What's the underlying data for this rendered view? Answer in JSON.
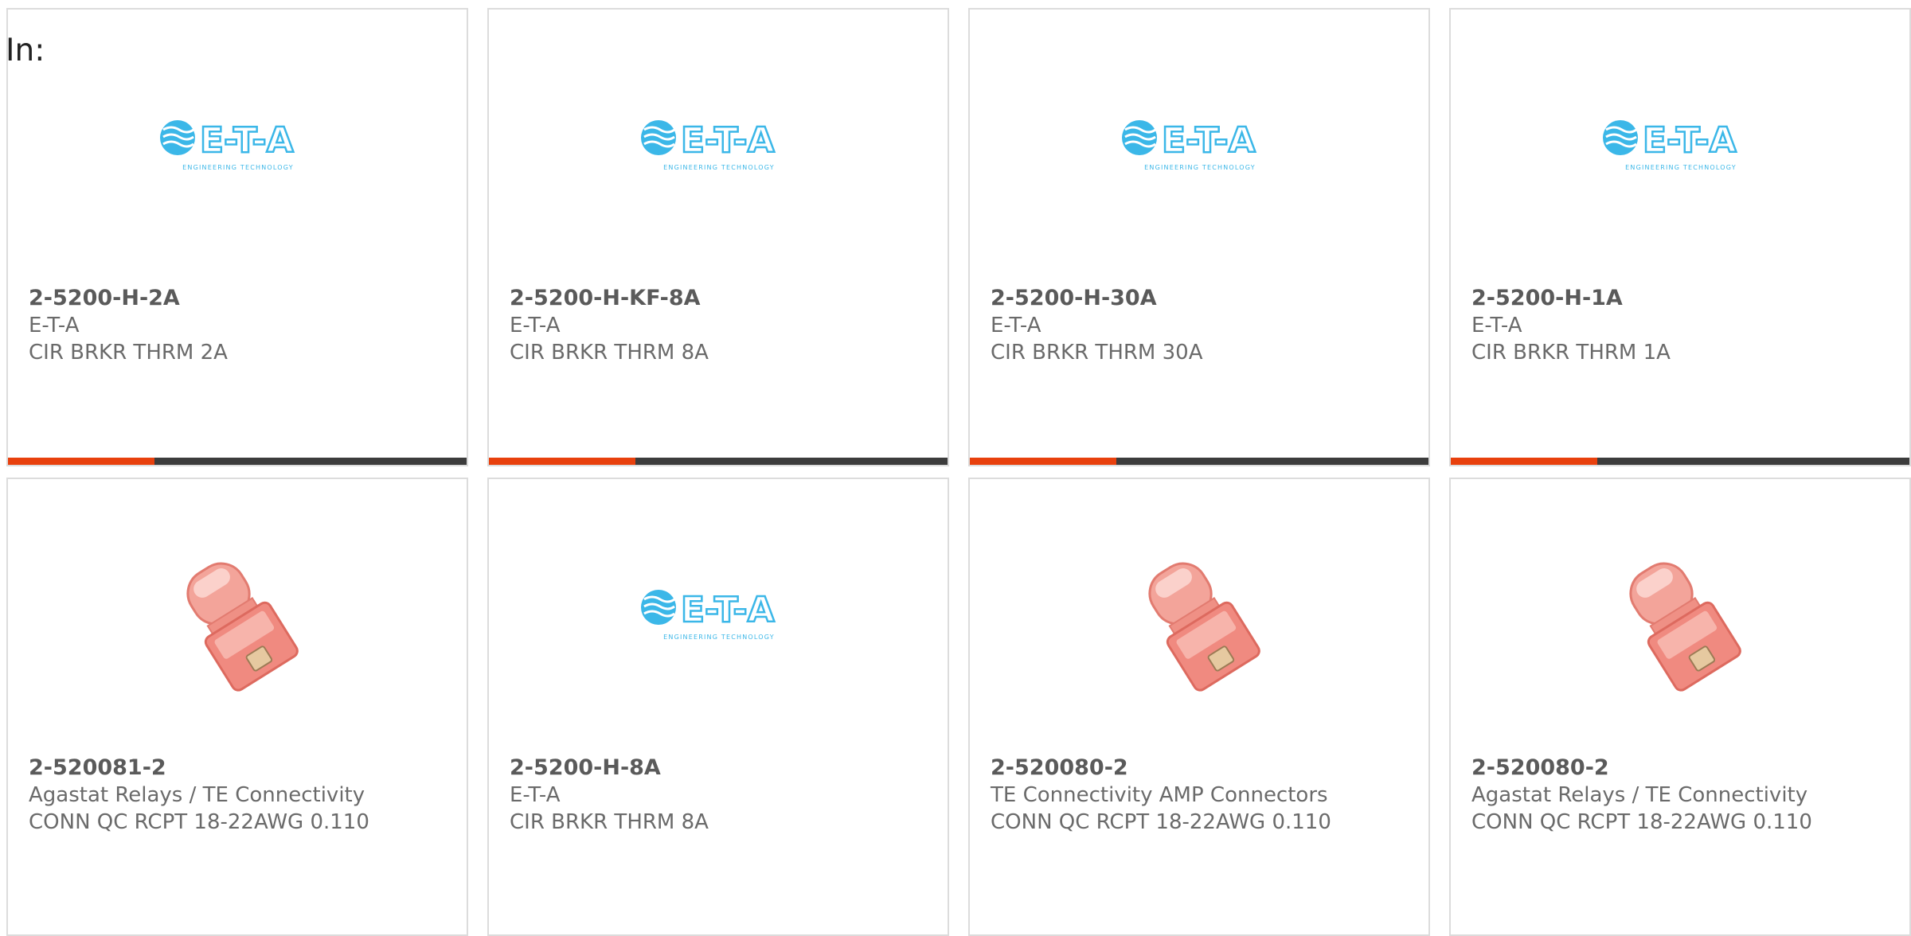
{
  "filter": {
    "label": "In:"
  },
  "colors": {
    "accent": "#e8400d",
    "bar_track": "#3c3c3c",
    "card_border": "#dcdcdc",
    "logo_blue": "#3bb7e8"
  },
  "products": [
    {
      "part_number": "2-5200-H-2A",
      "manufacturer": "E-T-A",
      "description": "CIR BRKR THRM 2A",
      "image": "eta-logo",
      "logo_text": "E-T-A",
      "logo_tagline": "ENGINEERING TECHNOLOGY",
      "progress": 0.32
    },
    {
      "part_number": "2-5200-H-KF-8A",
      "manufacturer": "E-T-A",
      "description": "CIR BRKR THRM 8A",
      "image": "eta-logo",
      "logo_text": "E-T-A",
      "logo_tagline": "ENGINEERING TECHNOLOGY",
      "progress": 0.32
    },
    {
      "part_number": "2-5200-H-30A",
      "manufacturer": "E-T-A",
      "description": "CIR BRKR THRM 30A",
      "image": "eta-logo",
      "logo_text": "E-T-A",
      "logo_tagline": "ENGINEERING TECHNOLOGY",
      "progress": 0.32
    },
    {
      "part_number": "2-5200-H-1A",
      "manufacturer": "E-T-A",
      "description": "CIR BRKR THRM 1A",
      "image": "eta-logo",
      "logo_text": "E-T-A",
      "logo_tagline": "ENGINEERING TECHNOLOGY",
      "progress": 0.32
    },
    {
      "part_number": "2-520081-2",
      "manufacturer": "Agastat Relays / TE Connectivity",
      "description": "CONN QC RCPT 18-22AWG 0.110",
      "image": "quick-connect-terminal"
    },
    {
      "part_number": "2-5200-H-8A",
      "manufacturer": "E-T-A",
      "description": "CIR BRKR THRM 8A",
      "image": "eta-logo",
      "logo_text": "E-T-A",
      "logo_tagline": "ENGINEERING TECHNOLOGY"
    },
    {
      "part_number": "2-520080-2",
      "manufacturer": "TE Connectivity AMP Connectors",
      "description": "CONN QC RCPT 18-22AWG 0.110",
      "image": "quick-connect-terminal"
    },
    {
      "part_number": "2-520080-2",
      "manufacturer": "Agastat Relays / TE Connectivity",
      "description": "CONN QC RCPT 18-22AWG 0.110",
      "image": "quick-connect-terminal"
    }
  ]
}
